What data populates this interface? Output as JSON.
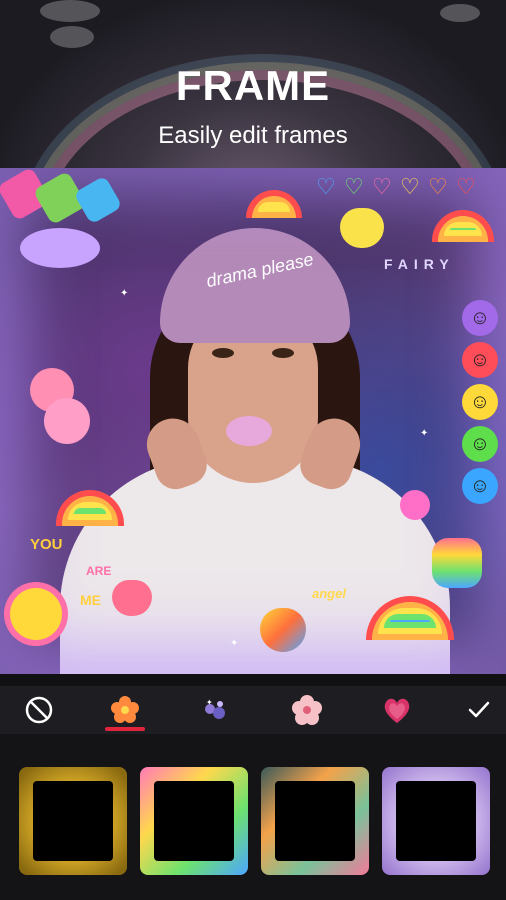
{
  "header": {
    "title": "FRAME",
    "subtitle": "Easily edit frames"
  },
  "canvas": {
    "beanie_text": "drama please",
    "sticker_words": {
      "fairy": "FAIRY",
      "you": "YOU",
      "are": "ARE",
      "me": "ME",
      "angel": "angel"
    }
  },
  "toolbar": {
    "items": [
      {
        "name": "none",
        "icon": "no-frame-icon"
      },
      {
        "name": "flower",
        "icon": "flower-icon",
        "active": true
      },
      {
        "name": "sparkle",
        "icon": "sparkle-icon"
      },
      {
        "name": "blossom",
        "icon": "blossom-icon"
      },
      {
        "name": "heart",
        "icon": "heart-icon"
      },
      {
        "name": "confirm",
        "icon": "check-icon"
      }
    ],
    "active_color": "#e0243c"
  },
  "thumbnails": [
    {
      "name": "yellow-flower-frame",
      "accent": "#f2c230"
    },
    {
      "name": "rainbow-sticker-frame",
      "accent": "#ff7ab8"
    },
    {
      "name": "floral-frame",
      "accent": "#f4a24a"
    },
    {
      "name": "purple-cloud-frame",
      "accent": "#b89ad8"
    }
  ]
}
